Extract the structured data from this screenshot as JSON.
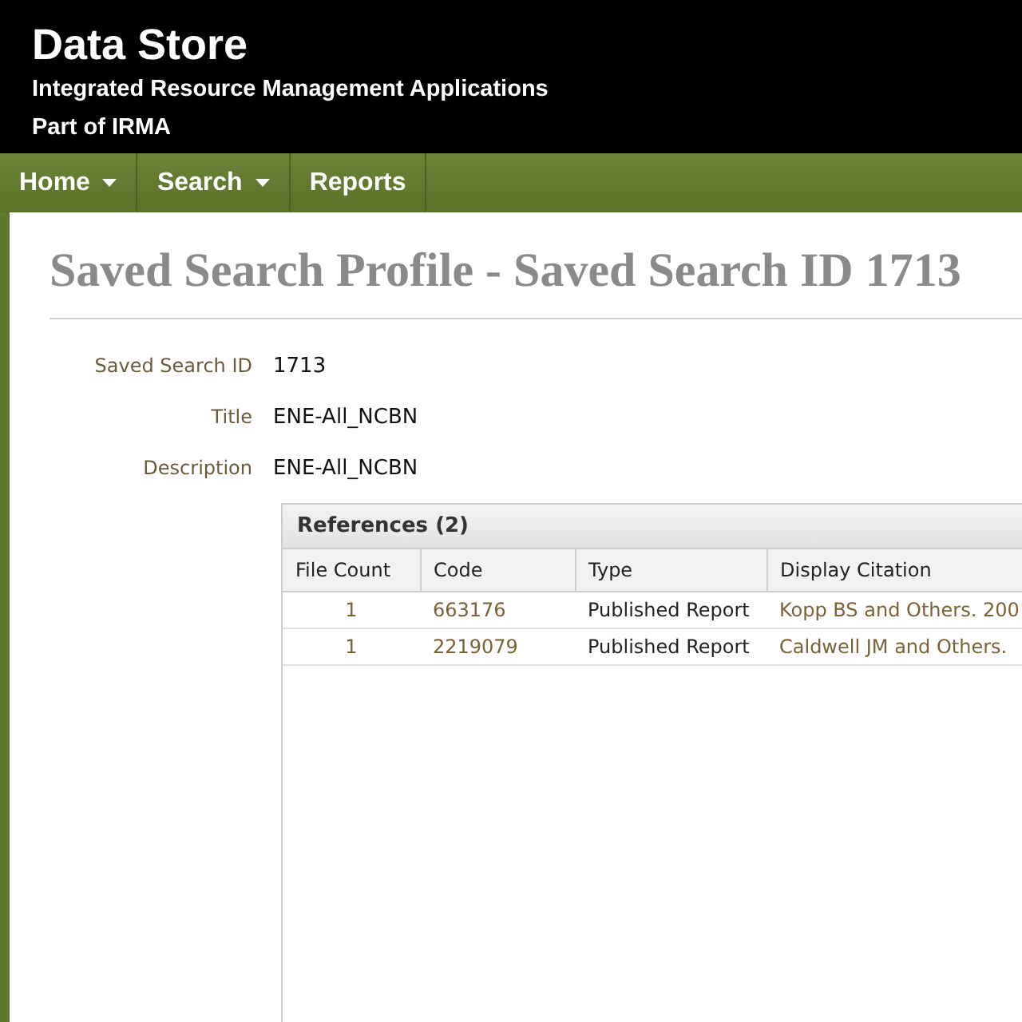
{
  "header": {
    "title": "Data Store",
    "subtitle": "Integrated Resource Management Applications",
    "parent": "Part of IRMA"
  },
  "nav": [
    {
      "label": "Home",
      "dropdown": true
    },
    {
      "label": "Search",
      "dropdown": true
    },
    {
      "label": "Reports",
      "dropdown": false
    }
  ],
  "page_title": "Saved Search Profile - Saved Search ID 1713",
  "fields": [
    {
      "label": "Saved Search ID",
      "value": "1713"
    },
    {
      "label": "Title",
      "value": "ENE-All_NCBN"
    },
    {
      "label": "Description",
      "value": "ENE-All_NCBN"
    }
  ],
  "references": {
    "title": "References (2)",
    "columns": [
      "File Count",
      "Code",
      "Type",
      "Display Citation"
    ],
    "rows": [
      [
        "1",
        "663176",
        "Published Report",
        "Kopp BS and Others. 200"
      ],
      [
        "1",
        "2219079",
        "Published Report",
        "Caldwell JM and Others."
      ]
    ]
  }
}
